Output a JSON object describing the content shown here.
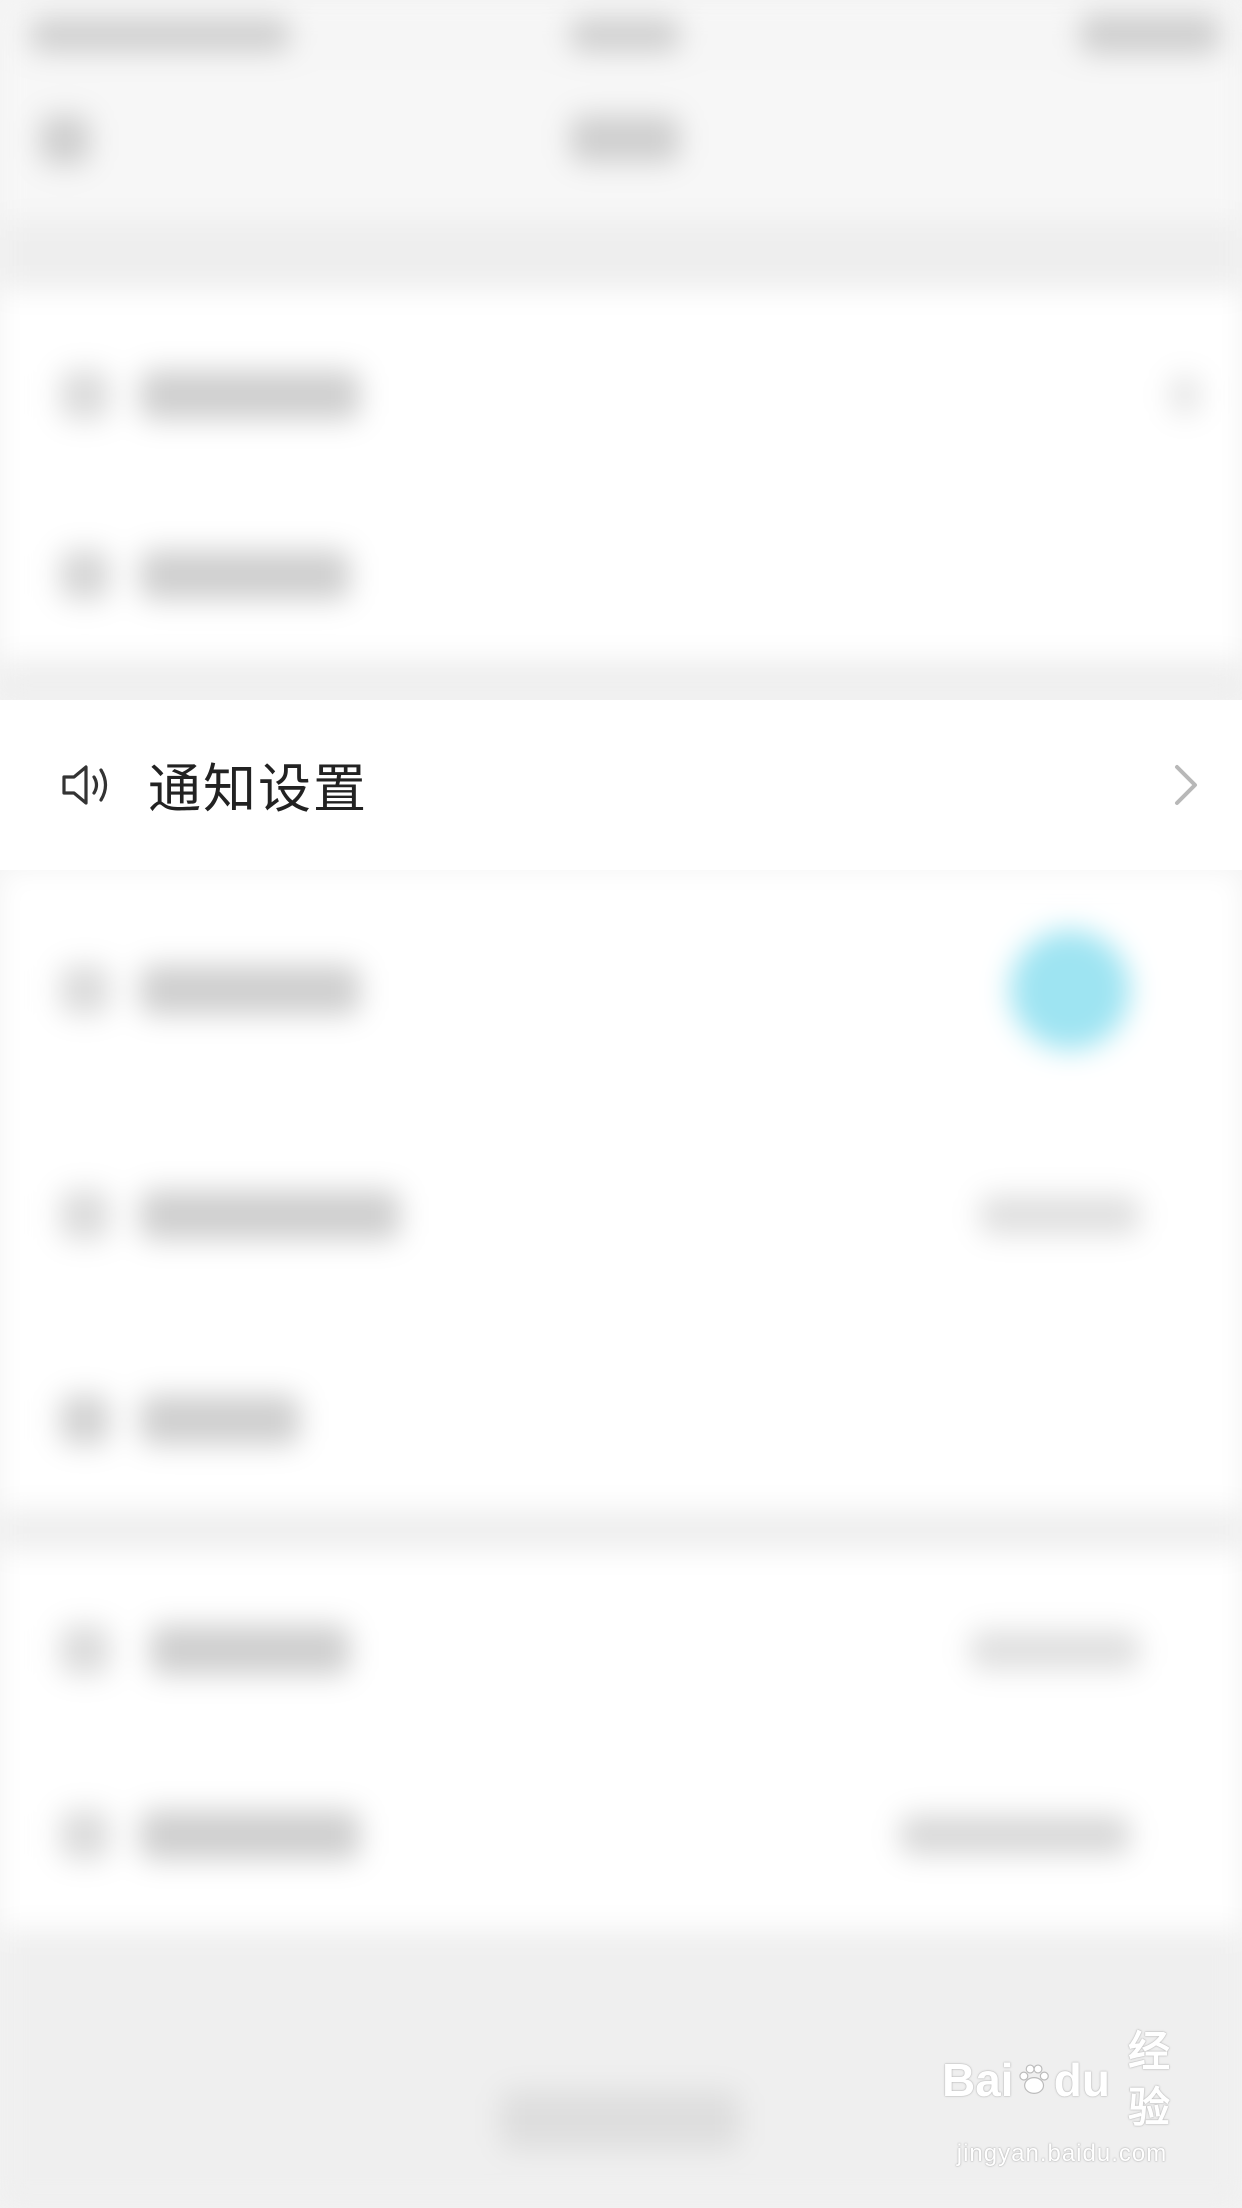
{
  "highlighted_row": {
    "icon": "speaker-icon",
    "label": "通知设置",
    "chevron": "chevron-right-icon"
  },
  "watermark": {
    "brand_left": "Bai",
    "brand_right": "du",
    "brand_cn": "经验",
    "url": "jingyan.baidu.com"
  },
  "colors": {
    "toggle_accent": "#9ee4f2",
    "text": "#222222",
    "background": "#f3f3f3"
  }
}
